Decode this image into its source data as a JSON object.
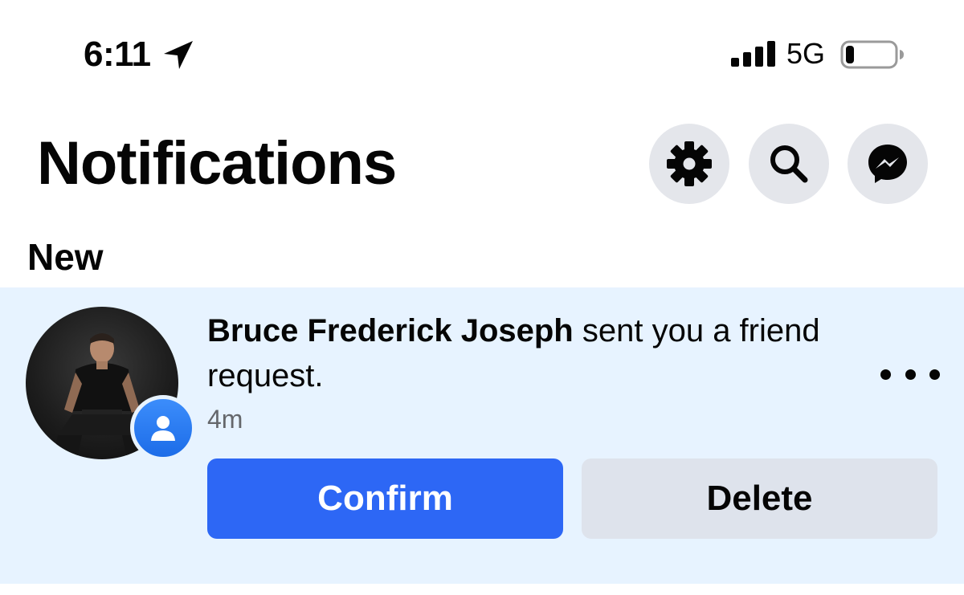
{
  "status_bar": {
    "time": "6:11",
    "network": "5G",
    "icons": [
      "location-arrow-icon",
      "signal-bars-icon",
      "battery-icon"
    ],
    "battery_level": 0.18
  },
  "header": {
    "title": "Notifications",
    "buttons": [
      "settings-gear-icon",
      "search-icon",
      "messenger-icon"
    ]
  },
  "section": {
    "heading": "New"
  },
  "notification": {
    "actor_name": "Bruce Frederick Joseph",
    "message": " sent you a friend request.",
    "time_ago": "4m",
    "badge_icon": "friend-request-person-icon",
    "more_icon": "more-options-icon",
    "confirm_label": "Confirm",
    "delete_label": "Delete"
  },
  "colors": {
    "unread_background": "#e7f3ff",
    "confirm_button": "#2d67f5",
    "delete_button": "#dee3ec",
    "icon_button_bg": "#e4e6eb",
    "secondary_text": "#65676b"
  }
}
